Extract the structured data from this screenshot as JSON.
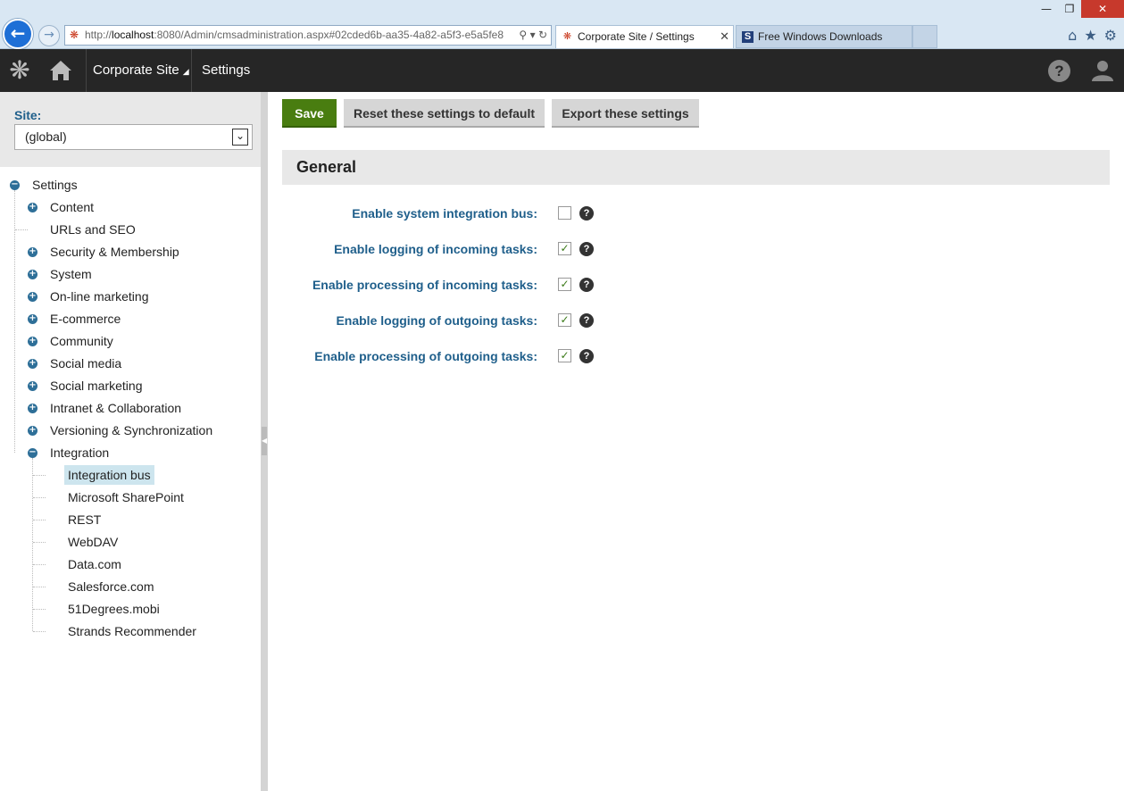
{
  "browser": {
    "address": "http://localhost:8080/Admin/cmsadministration.aspx#02cded6b-aa35-4a82-a5f3-e5a5fe8",
    "address_host_prefix": "http://",
    "address_host": "localhost",
    "address_rest": ":8080/Admin/cmsadministration.aspx#02cded6b-aa35-4a82-a5f3-e5a5fe8",
    "tabs": [
      {
        "label": "Corporate Site / Settings",
        "active": true
      },
      {
        "label": "Free Windows Downloads",
        "active": false
      }
    ],
    "inactive_tab_icon_letter": "S"
  },
  "header": {
    "site_name": "Corporate Site",
    "section": "Settings"
  },
  "sidebar": {
    "site_label": "Site:",
    "site_value": "(global)",
    "tree": [
      {
        "label": "Settings",
        "level": 0,
        "toggle": "minus"
      },
      {
        "label": "Content",
        "level": 1,
        "toggle": "plus"
      },
      {
        "label": "URLs and SEO",
        "level": 1,
        "toggle": "none"
      },
      {
        "label": "Security & Membership",
        "level": 1,
        "toggle": "plus"
      },
      {
        "label": "System",
        "level": 1,
        "toggle": "plus"
      },
      {
        "label": "On-line marketing",
        "level": 1,
        "toggle": "plus"
      },
      {
        "label": "E-commerce",
        "level": 1,
        "toggle": "plus"
      },
      {
        "label": "Community",
        "level": 1,
        "toggle": "plus"
      },
      {
        "label": "Social media",
        "level": 1,
        "toggle": "plus"
      },
      {
        "label": "Social marketing",
        "level": 1,
        "toggle": "plus"
      },
      {
        "label": "Intranet & Collaboration",
        "level": 1,
        "toggle": "plus"
      },
      {
        "label": "Versioning & Synchronization",
        "level": 1,
        "toggle": "plus"
      },
      {
        "label": "Integration",
        "level": 1,
        "toggle": "minus"
      },
      {
        "label": "Integration bus",
        "level": 2,
        "toggle": "none",
        "selected": true
      },
      {
        "label": "Microsoft SharePoint",
        "level": 2,
        "toggle": "none"
      },
      {
        "label": "REST",
        "level": 2,
        "toggle": "none"
      },
      {
        "label": "WebDAV",
        "level": 2,
        "toggle": "none"
      },
      {
        "label": "Data.com",
        "level": 2,
        "toggle": "none"
      },
      {
        "label": "Salesforce.com",
        "level": 2,
        "toggle": "none"
      },
      {
        "label": "51Degrees.mobi",
        "level": 2,
        "toggle": "none"
      },
      {
        "label": "Strands Recommender",
        "level": 2,
        "toggle": "none"
      }
    ]
  },
  "toolbar": {
    "save_label": "Save",
    "reset_label": "Reset these settings to default",
    "export_label": "Export these settings"
  },
  "section": {
    "title": "General",
    "settings": [
      {
        "label": "Enable system integration bus:",
        "checked": false
      },
      {
        "label": "Enable logging of incoming tasks:",
        "checked": true
      },
      {
        "label": "Enable processing of incoming tasks:",
        "checked": true
      },
      {
        "label": "Enable logging of outgoing tasks:",
        "checked": true
      },
      {
        "label": "Enable processing of outgoing tasks:",
        "checked": true
      }
    ]
  },
  "colors": {
    "header_bg": "#262626",
    "accent_blue": "#1f5f8b",
    "save_green": "#497d10",
    "selected_bg": "#cde5ee"
  },
  "icons": {
    "help_glyph": "?",
    "check_glyph": "✓"
  }
}
